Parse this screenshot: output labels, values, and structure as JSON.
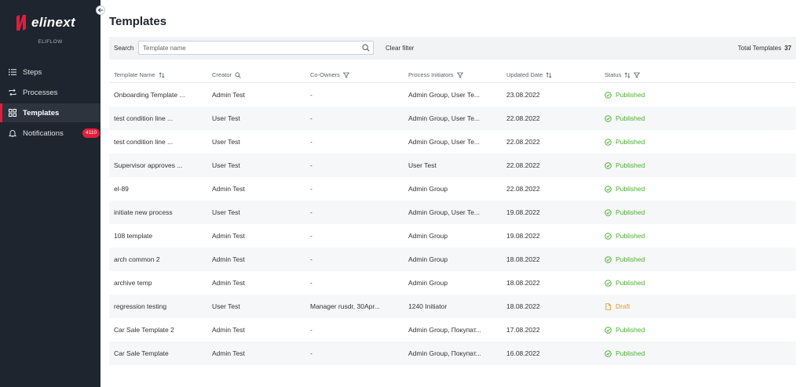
{
  "sidebar": {
    "logo_text": "elinext",
    "product_name": "ELIFLOW",
    "items": [
      {
        "label": "Steps",
        "icon": "list-icon"
      },
      {
        "label": "Processes",
        "icon": "repeat-icon"
      },
      {
        "label": "Templates",
        "icon": "grid-icon",
        "active": true
      },
      {
        "label": "Notifications",
        "icon": "bell-icon",
        "badge": "4110"
      }
    ]
  },
  "page": {
    "title": "Templates"
  },
  "toolbar": {
    "search_label": "Search",
    "search_placeholder": "Template name",
    "clear_filter": "Clear filter",
    "total_label": "Total Templates",
    "total_count": "37"
  },
  "table": {
    "columns": [
      "Template Name",
      "Creator",
      "Co-Owners",
      "Process Initiators",
      "Updated Date",
      "Status"
    ],
    "rows": [
      {
        "name": "Onboarding Template ...",
        "creator": "Admin Test",
        "coowners": "-",
        "initiators": "Admin Group, User Te...",
        "date": "23.08.2022",
        "status": "Published"
      },
      {
        "name": "test condition line ...",
        "creator": "User Test",
        "coowners": "-",
        "initiators": "Admin Group, User Te...",
        "date": "22.08.2022",
        "status": "Published"
      },
      {
        "name": "test condition line ...",
        "creator": "User Test",
        "coowners": "-",
        "initiators": "Admin Group, User Te...",
        "date": "22.08.2022",
        "status": "Published"
      },
      {
        "name": "Supervisor approves ...",
        "creator": "User Test",
        "coowners": "-",
        "initiators": "User Test",
        "date": "22.08.2022",
        "status": "Published"
      },
      {
        "name": "el-89",
        "creator": "Admin Test",
        "coowners": "-",
        "initiators": "Admin Group",
        "date": "22.08.2022",
        "status": "Published"
      },
      {
        "name": "initiate new process",
        "creator": "User Test",
        "coowners": "-",
        "initiators": "Admin Group, User Te...",
        "date": "19.08.2022",
        "status": "Published"
      },
      {
        "name": "108 template",
        "creator": "Admin Test",
        "coowners": "-",
        "initiators": "Admin Group",
        "date": "19.08.2022",
        "status": "Published"
      },
      {
        "name": "arch common 2",
        "creator": "Admin Test",
        "coowners": "-",
        "initiators": "Admin Group",
        "date": "18.08.2022",
        "status": "Published"
      },
      {
        "name": "archive temp",
        "creator": "Admin Test",
        "coowners": "-",
        "initiators": "Admin Group",
        "date": "18.08.2022",
        "status": "Published"
      },
      {
        "name": "regression testing",
        "creator": "User Test",
        "coowners": "Manager rusdr, 30Apr...",
        "initiators": "1240 Initiator",
        "date": "18.08.2022",
        "status": "Draft"
      },
      {
        "name": "Car Sale Template 2",
        "creator": "Admin Test",
        "coowners": "-",
        "initiators": "Admin Group, Покупат...",
        "date": "17.08.2022",
        "status": "Published"
      },
      {
        "name": "Car Sale Template",
        "creator": "Admin Test",
        "coowners": "-",
        "initiators": "Admin Group, Покупат...",
        "date": "16.08.2022",
        "status": "Published"
      }
    ]
  },
  "colors": {
    "sidebar_bg": "#1f252e",
    "accent_red": "#e01e3c",
    "published_green": "#4caf32",
    "draft_orange": "#e99a2d"
  }
}
